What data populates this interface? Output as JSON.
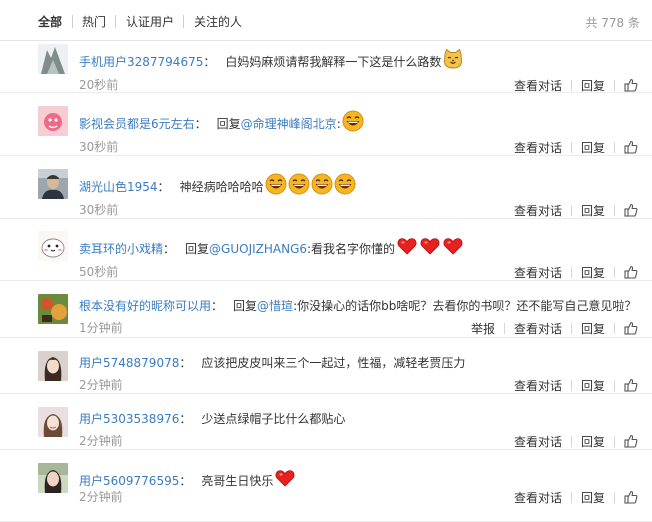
{
  "tabs": [
    {
      "label": "全部",
      "active": true
    },
    {
      "label": "热门",
      "active": false
    },
    {
      "label": "认证用户",
      "active": false
    },
    {
      "label": "关注的人",
      "active": false
    }
  ],
  "total_label": "共 778 条",
  "colors": {
    "link": "#3a7cc1",
    "text": "#333333",
    "muted": "#999999"
  },
  "action_labels": {
    "view_conversation": "查看对话",
    "reply": "回复",
    "report": "举报"
  },
  "comments": [
    {
      "user": "手机用户3287794675",
      "text_before": "白妈妈麻烦请帮我解释一下这是什么路数",
      "mention": "",
      "text_after": "",
      "emojis": [
        "cat-face-emoji"
      ],
      "time": "20秒前",
      "show_report": false
    },
    {
      "user": "影视会员都是6元左右",
      "text_before": "回复",
      "mention": "@命理神峰阁北京",
      "text_after": ":",
      "emojis": [
        "laughing-emoji"
      ],
      "time": "30秒前",
      "show_report": false
    },
    {
      "user": "湖光山色1954",
      "text_before": "神经病哈哈哈哈",
      "mention": "",
      "text_after": "",
      "emojis": [
        "laughing-emoji",
        "laughing-emoji",
        "laughing-emoji",
        "laughing-emoji"
      ],
      "time": "30秒前",
      "show_report": false
    },
    {
      "user": "卖耳环的小戏精",
      "text_before": "回复",
      "mention": "@GUOJIZHANG6",
      "text_after": ":看我名字你懂的",
      "emojis": [
        "heart-emoji",
        "heart-emoji",
        "heart-emoji"
      ],
      "time": "50秒前",
      "show_report": false
    },
    {
      "user": "根本没有好的昵称可以用",
      "text_before": "回复",
      "mention": "@惜瑄",
      "text_after": ":你没操心的话你bb啥呢？去看你的书呗？还不能写自己意见啦？",
      "emojis": [],
      "time": "1分钟前",
      "show_report": true
    },
    {
      "user": "用户5748879078",
      "text_before": "应该把皮皮叫来三个一起过，性福，减轻老贾压力",
      "mention": "",
      "text_after": "",
      "emojis": [],
      "time": "2分钟前",
      "show_report": false
    },
    {
      "user": "用户5303538976",
      "text_before": "少送点绿帽子比什么都贴心",
      "mention": "",
      "text_after": "",
      "emojis": [],
      "time": "2分钟前",
      "show_report": false
    },
    {
      "user": "用户5609776595",
      "text_before": "亮哥生日快乐",
      "mention": "",
      "text_after": "",
      "emojis": [
        "heart-emoji"
      ],
      "time": "2分钟前",
      "show_report": false
    }
  ]
}
